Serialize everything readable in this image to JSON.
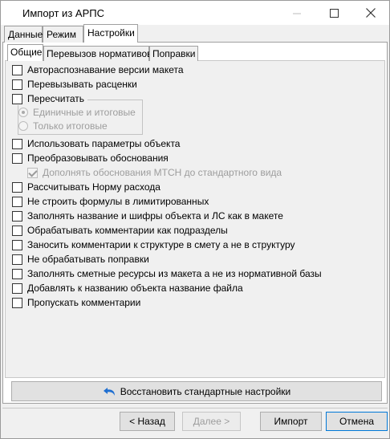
{
  "window": {
    "title": "Импорт из АРПС"
  },
  "tabs_top": [
    {
      "label": "Данные"
    },
    {
      "label": "Режим"
    },
    {
      "label": "Настройки"
    }
  ],
  "tabs_sub": [
    {
      "label": "Общие"
    },
    {
      "label": "Перевызов нормативов"
    },
    {
      "label": "Поправки"
    }
  ],
  "options": [
    {
      "label": "Автораспознавание версии макета",
      "checked": false
    },
    {
      "label": "Перевызывать расценки",
      "checked": false
    },
    {
      "label": "Пересчитать",
      "checked": false
    },
    {
      "label": "Единичные и итоговые",
      "checked": true,
      "disabled": true
    },
    {
      "label": "Только итоговые",
      "checked": false,
      "disabled": true
    },
    {
      "label": "Использовать параметры объекта",
      "checked": false
    },
    {
      "label": "Преобразовывать обоснования",
      "checked": false
    },
    {
      "label": "Дополнять обоснования МТСН до стандартного вида",
      "checked": true,
      "disabled": true
    },
    {
      "label": "Рассчитывать Норму расхода",
      "checked": false
    },
    {
      "label": "Не строить формулы в лимитированных",
      "checked": false
    },
    {
      "label": "Заполнять название и шифры объекта и ЛС как в макете",
      "checked": false
    },
    {
      "label": "Обрабатывать комментарии как подразделы",
      "checked": false
    },
    {
      "label": "Заносить комментарии к структуре в смету а не в структуру",
      "checked": false
    },
    {
      "label": "Не обрабатывать поправки",
      "checked": false
    },
    {
      "label": "Заполнять сметные ресурсы из макета а не из нормативной базы",
      "checked": false
    },
    {
      "label": "Добавлять к названию объекта название файла",
      "checked": false
    },
    {
      "label": "Пропускать комментарии",
      "checked": false
    }
  ],
  "restore_button": {
    "label": "Восстановить стандартные настройки",
    "icon": "undo-arrow-icon",
    "icon_color": "#1f6fd1"
  },
  "buttons": {
    "back": "< Назад",
    "next": "Далее >",
    "import": "Импорт",
    "cancel": "Отмена"
  }
}
